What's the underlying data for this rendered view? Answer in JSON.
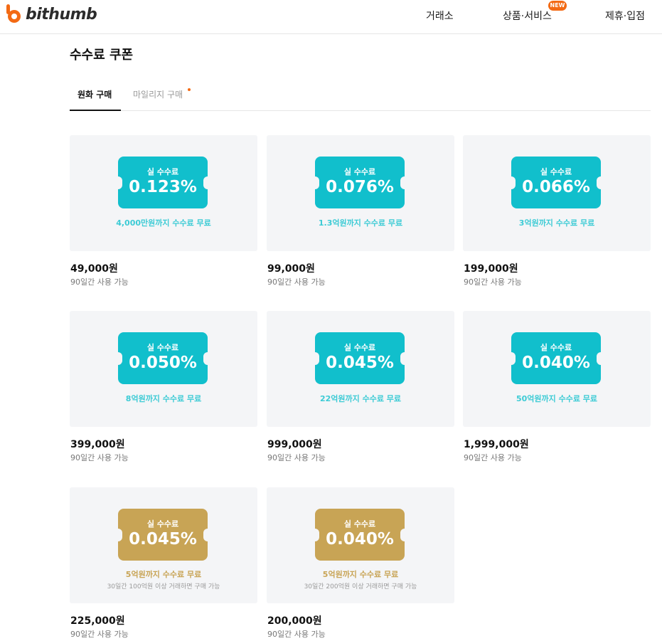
{
  "header": {
    "logo_text": "bithumb",
    "nav": [
      {
        "label": "거래소"
      },
      {
        "label": "상품·서비스",
        "badge": "NEW"
      },
      {
        "label": "제휴·입점"
      }
    ]
  },
  "page_title": "수수료 쿠폰",
  "tabs": [
    {
      "label": "원화 구매",
      "active": true
    },
    {
      "label": "마일리지 구매",
      "active": false
    }
  ],
  "colors": {
    "teal": "#11bfcc",
    "gold": "#c8a455",
    "accent": "#f36a14"
  },
  "coupons": [
    {
      "label": "실 수수료",
      "rate": "0.123%",
      "desc": "4,000만원까지 수수료 무료",
      "price": "49,000원",
      "period": "90일간 사용 가능",
      "color": "teal"
    },
    {
      "label": "실 수수료",
      "rate": "0.076%",
      "desc": "1.3억원까지 수수료 무료",
      "price": "99,000원",
      "period": "90일간 사용 가능",
      "color": "teal"
    },
    {
      "label": "실 수수료",
      "rate": "0.066%",
      "desc": "3억원까지 수수료 무료",
      "price": "199,000원",
      "period": "90일간 사용 가능",
      "color": "teal"
    },
    {
      "label": "실 수수료",
      "rate": "0.050%",
      "desc": "8억원까지 수수료 무료",
      "price": "399,000원",
      "period": "90일간 사용 가능",
      "color": "teal"
    },
    {
      "label": "실 수수료",
      "rate": "0.045%",
      "desc": "22억원까지 수수료 무료",
      "price": "999,000원",
      "period": "90일간 사용 가능",
      "color": "teal"
    },
    {
      "label": "실 수수료",
      "rate": "0.040%",
      "desc": "50억원까지 수수료 무료",
      "price": "1,999,000원",
      "period": "90일간 사용 가능",
      "color": "teal"
    },
    {
      "label": "실 수수료",
      "rate": "0.045%",
      "desc": "5억원까지 수수료 무료",
      "sub": "30일간 100억원 이상 거래하면 구매 가능",
      "price": "225,000원",
      "period": "90일간 사용 가능",
      "color": "gold"
    },
    {
      "label": "실 수수료",
      "rate": "0.040%",
      "desc": "5억원까지 수수료 무료",
      "sub": "30일간 200억원 이상 거래하면 구매 가능",
      "price": "200,000원",
      "period": "90일간 사용 가능",
      "color": "gold"
    }
  ]
}
